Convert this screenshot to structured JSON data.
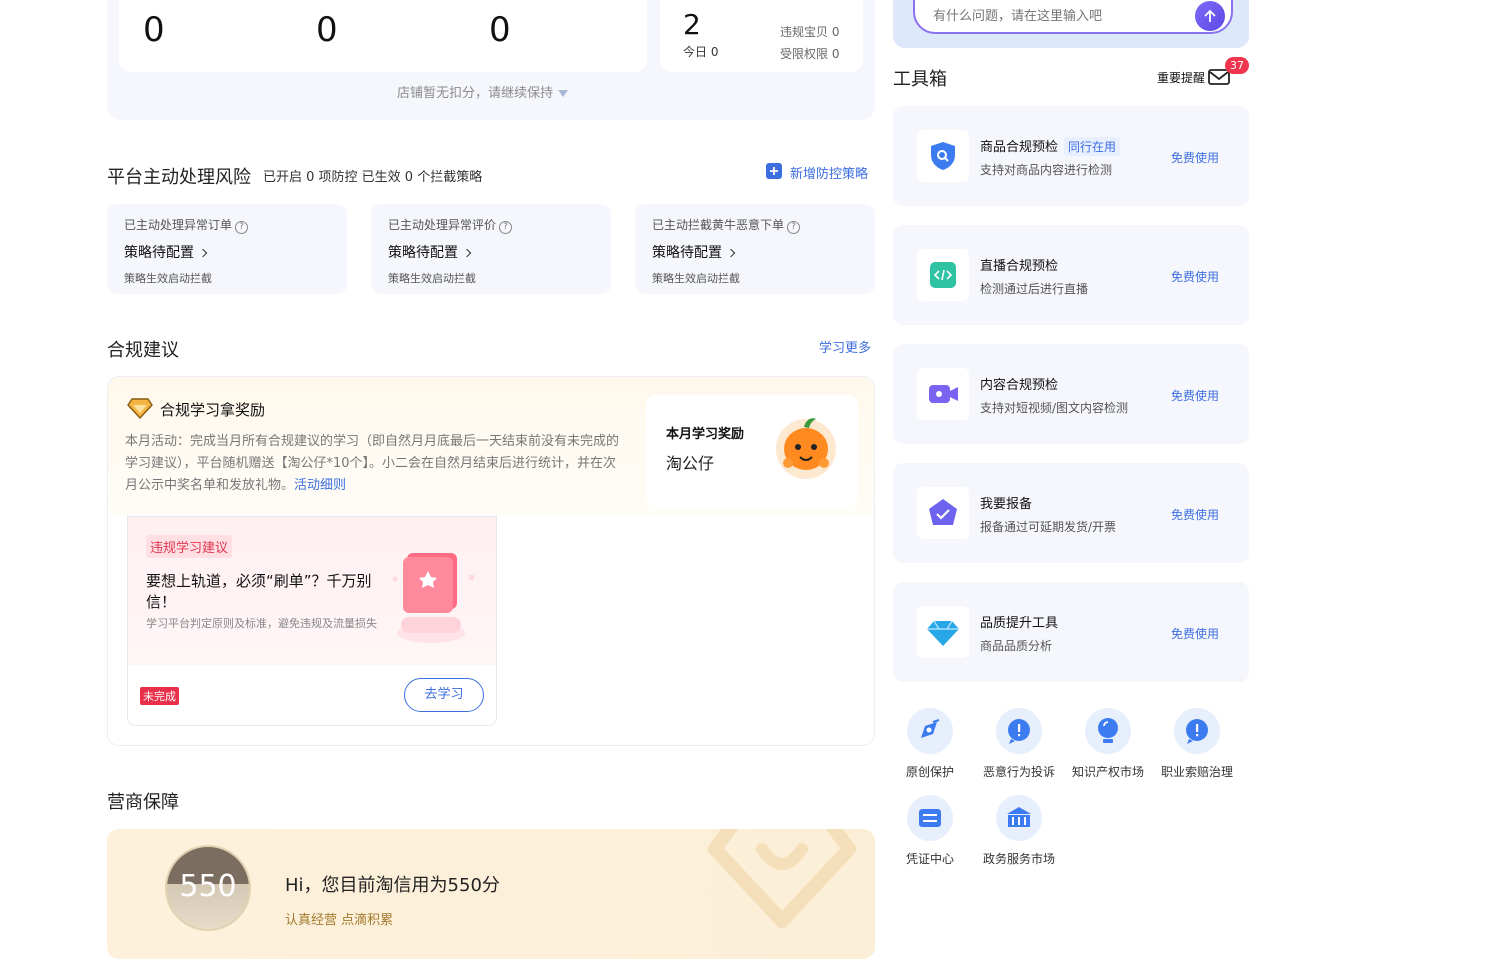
{
  "stats": {
    "counts": [
      "0",
      "0",
      "0"
    ],
    "today_value": "2",
    "today_label": "今日 0",
    "violation_items": "违规宝贝 0",
    "restricted_perm": "受限权限 0",
    "no_deduction_note": "店铺暂无扣分，请继续保持"
  },
  "platform_risk": {
    "title": "平台主动处理风险",
    "summary": "已开启 0 项防控 已生效 0 个拦截策略",
    "add_strategy": "新增防控策略",
    "cards": [
      {
        "title": "已主动处理异常订单",
        "status": "策略待配置",
        "footer": "策略生效启动拦截"
      },
      {
        "title": "已主动处理异常评价",
        "status": "策略待配置",
        "footer": "策略生效启动拦截"
      },
      {
        "title": "已主动拦截黄牛恶意下单",
        "status": "策略待配置",
        "footer": "策略生效启动拦截"
      }
    ]
  },
  "compliance": {
    "title": "合规建议",
    "learn_more": "学习更多",
    "reward_title": "合规学习拿奖励",
    "activity_text": "本月活动：完成当月所有合规建议的学习（即自然月月底最后一天结束前没有未完成的学习建议），平台随机赠送【淘公仔*10个】。小二会在自然月结束后进行统计，并在次月公示中奖名单和发放礼物。",
    "activity_link": "活动细则",
    "monthly_reward_label": "本月学习奖励",
    "monthly_reward_item": "淘公仔",
    "study": {
      "tag": "违规学习建议",
      "headline": "要想上轨道，必须“刷单”？千万别信！",
      "desc": "学习平台判定原则及标准，避免违规及流量损失",
      "status": "未完成",
      "button": "去学习"
    }
  },
  "business": {
    "title": "营商保障",
    "score": "550",
    "greeting": "Hi，您目前淘信用为550分",
    "slogan": "认真经营 点滴积累"
  },
  "right": {
    "search_placeholder": "有什么问题，请在这里输入吧",
    "toolbox_title": "工具箱",
    "important_label": "重要提醒",
    "badge_count": "37",
    "tools": [
      {
        "name": "商品合规预检",
        "tag": "同行在用",
        "desc": "支持对商品内容进行检测",
        "action": "免费使用",
        "icon": "shield-search-icon"
      },
      {
        "name": "直播合规预检",
        "tag": "",
        "desc": "检测通过后进行直播",
        "action": "免费使用",
        "icon": "code-icon"
      },
      {
        "name": "内容合规预检",
        "tag": "",
        "desc": "支持对短视频/图文内容检测",
        "action": "免费使用",
        "icon": "video-icon"
      },
      {
        "name": "我要报备",
        "tag": "",
        "desc": "报备通过可延期发货/开票",
        "action": "免费使用",
        "icon": "check-badge-icon"
      },
      {
        "name": "品质提升工具",
        "tag": "",
        "desc": "商品品质分析",
        "action": "免费使用",
        "icon": "diamond-icon"
      }
    ],
    "services": [
      {
        "label": "原创保护",
        "icon": "original-protect-icon"
      },
      {
        "label": "恶意行为投诉",
        "icon": "malicious-complaint-icon"
      },
      {
        "label": "知识产权市场",
        "icon": "ip-market-icon"
      },
      {
        "label": "职业索赔治理",
        "icon": "claim-governance-icon"
      },
      {
        "label": "凭证中心",
        "icon": "voucher-center-icon"
      },
      {
        "label": "政务服务市场",
        "icon": "gov-service-icon"
      }
    ]
  }
}
